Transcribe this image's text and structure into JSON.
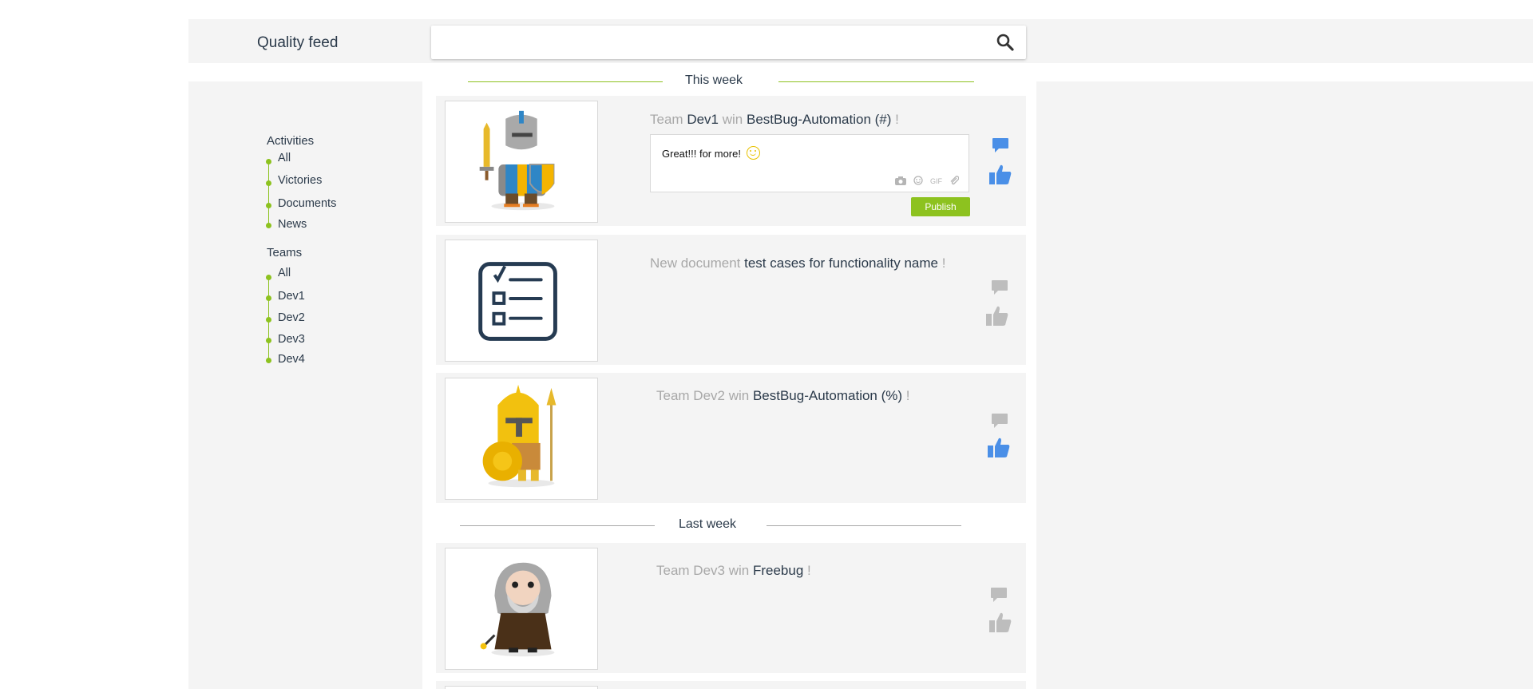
{
  "header": {
    "brand": "Quality feed",
    "search": {
      "value": "",
      "placeholder": ""
    }
  },
  "sidebar": {
    "activities": {
      "title": "Activities",
      "items": [
        "All",
        "Victories",
        "Documents",
        "News"
      ]
    },
    "teams": {
      "title": "Teams",
      "items": [
        "All",
        "Dev1",
        "Dev2",
        "Dev3",
        "Dev4"
      ]
    }
  },
  "sections": {
    "this_week": "This week",
    "last_week": "Last week"
  },
  "feed": [
    {
      "parts": [
        "Team",
        "Dev1",
        "win",
        "BestBug-Automation (#)",
        "!"
      ],
      "comment": {
        "text": "Great!!! for more!",
        "publish_label": "Publish",
        "tools": [
          "camera-icon",
          "emoji-icon",
          "GIF",
          "attach-icon"
        ]
      },
      "comment_active": true,
      "liked": true
    },
    {
      "parts": [
        "New document",
        "test cases for functionality name",
        "!"
      ],
      "comment_active": false,
      "liked": false
    },
    {
      "parts": [
        "Team Dev2 win",
        "BestBug-Automation (%)",
        "!"
      ],
      "comment_active": false,
      "liked": true
    },
    {
      "parts": [
        "Team Dev3 win",
        "Freebug",
        "!"
      ],
      "comment_active": false,
      "liked": false
    }
  ],
  "colors": {
    "accent_green": "#8dc21f",
    "action_blue": "#4a8fe7",
    "action_grey": "#bdbdbd",
    "muted_text": "#a8a8a8"
  }
}
